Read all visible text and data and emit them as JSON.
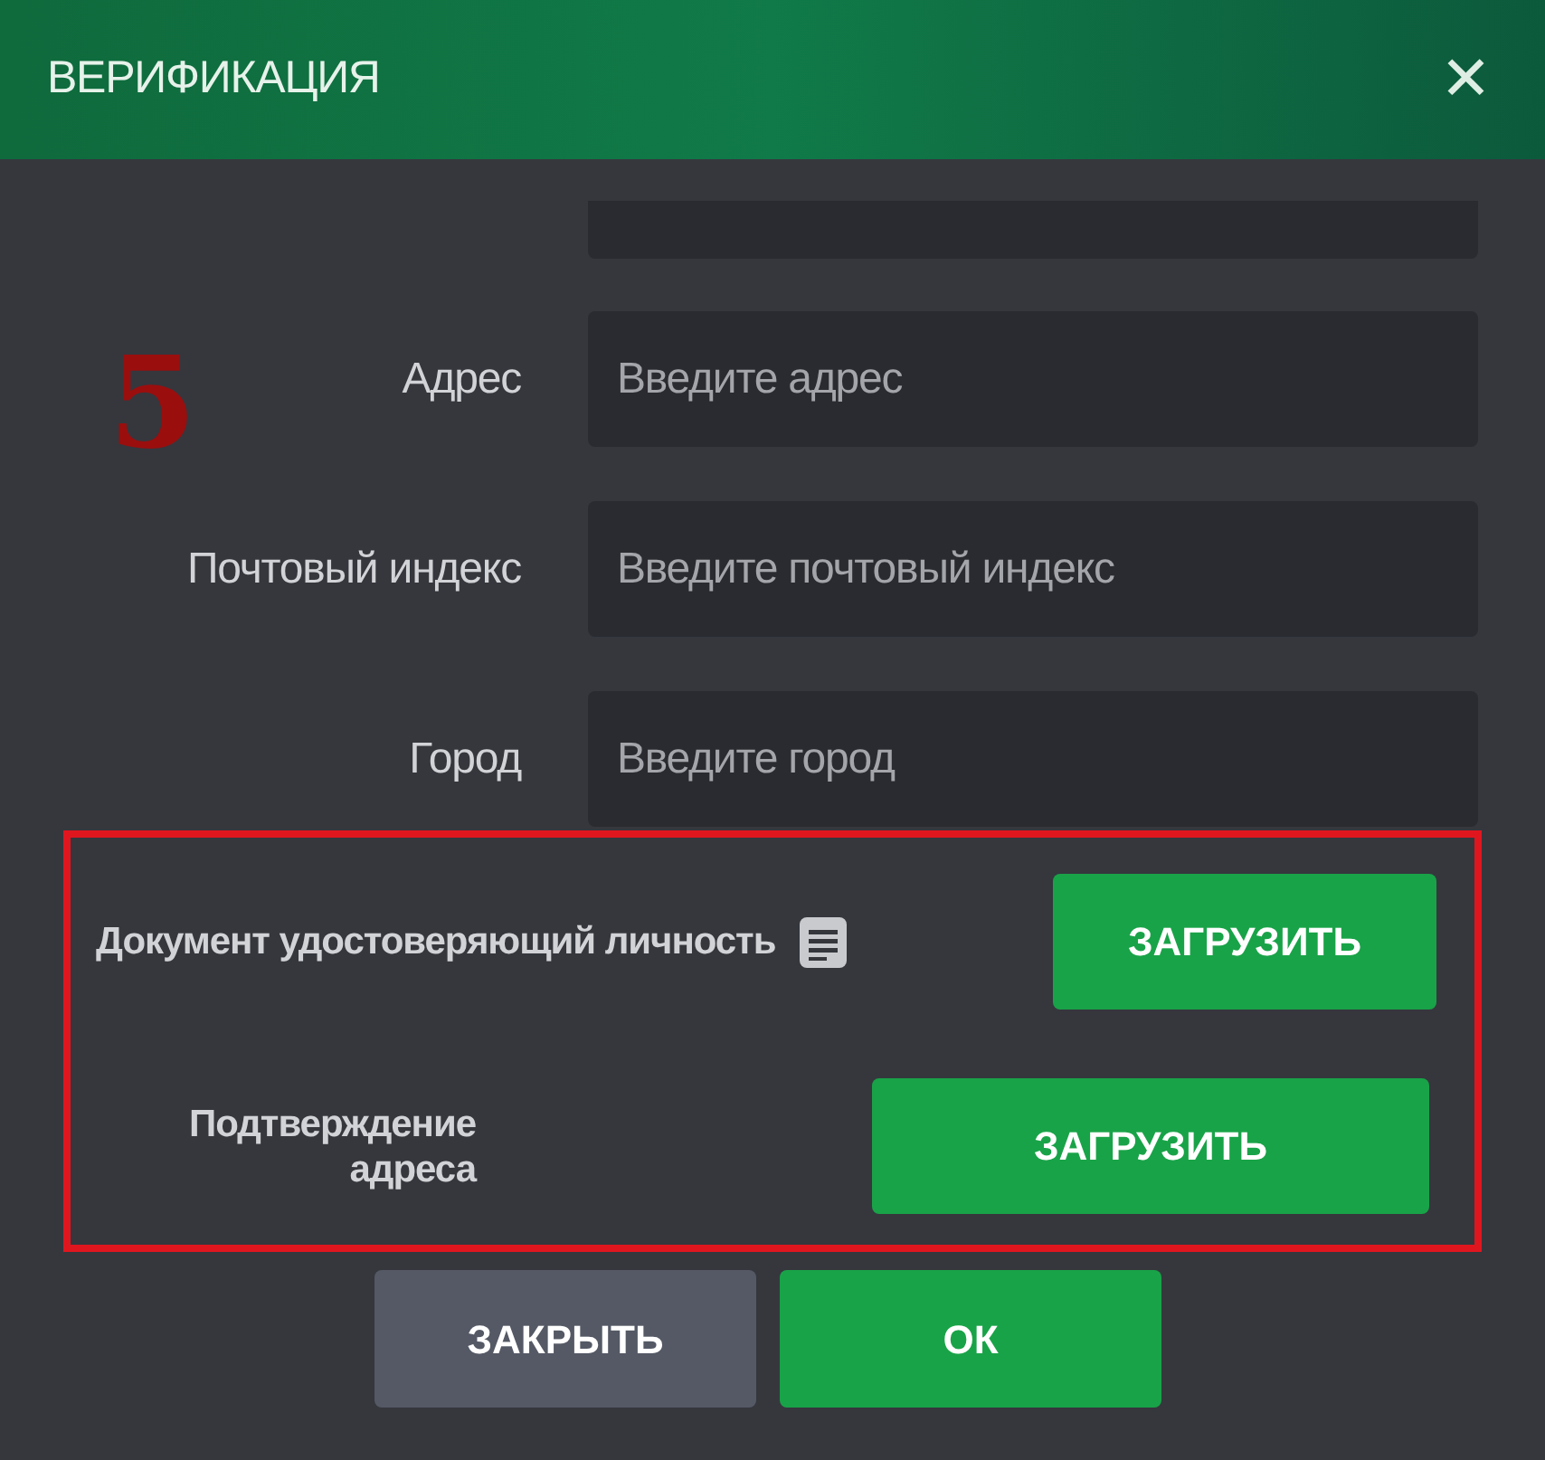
{
  "window": {
    "title": "ВЕРИФИКАЦИЯ",
    "close": "✕"
  },
  "annotation": "5",
  "fields": [
    {
      "label": "Адрес",
      "placeholder": "Введите адрес"
    },
    {
      "label": "Почтовый индекс",
      "placeholder": "Введите почтовый индекс"
    },
    {
      "label": "Город",
      "placeholder": "Введите город"
    }
  ],
  "uploads": [
    {
      "label": "Документ удостоверяющий личность",
      "button": "ЗАГРУЗИТЬ",
      "has_info_icon": true
    },
    {
      "label": "Подтверждение адреса",
      "button": "ЗАГРУЗИТЬ",
      "has_info_icon": false
    }
  ],
  "buttons": [
    {
      "kind": "secondary",
      "label": "ЗАКРЫТЬ"
    },
    {
      "kind": "primary",
      "label": "ОК"
    }
  ]
}
